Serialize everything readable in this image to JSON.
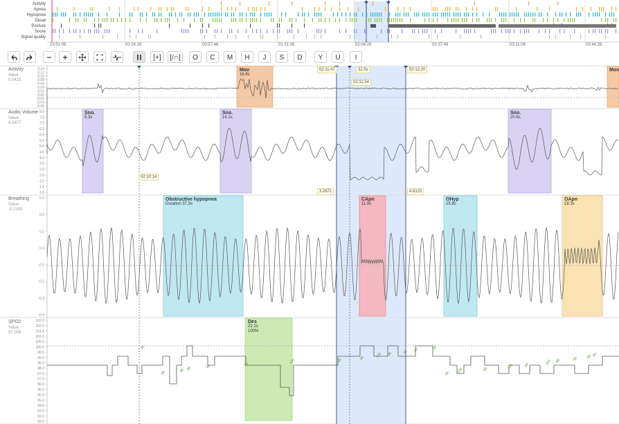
{
  "overview": {
    "row_labels": [
      "Activity",
      "Apnea",
      "Hypopnea",
      "Desat",
      "Posture",
      "Snore",
      "Signal quality"
    ],
    "time_labels": [
      "23:51:06",
      "00:24:26",
      "00:57:46",
      "01:31:06",
      "02:04:26",
      "02:37:46",
      "03:11:06",
      "03:44:26"
    ]
  },
  "toolbar": {
    "letters": [
      "O",
      "C",
      "M",
      "H",
      "J",
      "S",
      "D",
      "Y",
      "U",
      "I"
    ],
    "icons": [
      "undo-icon",
      "redo-icon",
      "zoom-out-icon",
      "zoom-in-icon",
      "move-icon",
      "fit-icon",
      "waveform-icon",
      "pause-icon",
      "expand-bracket-icon",
      "expand-wave-icon"
    ],
    "bracket_label": "[+]",
    "wave_label": "[/∩]"
  },
  "tracks": {
    "activity": {
      "name": "Activity",
      "value_label": "Value",
      "value": "0.0415",
      "ticks": [
        "0.14",
        "0.12",
        "0.10",
        "0.08",
        "0.06",
        "0.04",
        "0.02",
        "0.00",
        "-0.02",
        "-0.04",
        "-0.06"
      ]
    },
    "audio": {
      "name": "Audio Volume",
      "value_label": "Value",
      "value": "4.5677",
      "ticks": [
        "8.0",
        "7.5",
        "7.0",
        "6.5",
        "6.0",
        "5.5",
        "5.0",
        "4.5",
        "4.0",
        "3.5",
        "3.0",
        "2.5",
        "2.0",
        "1.5",
        "1.0"
      ]
    },
    "breathing": {
      "name": "Breathing",
      "value_label": "Value",
      "value": "-0.2183",
      "ticks": [
        "0.3",
        "0.2",
        "0.1",
        "0.0",
        "-0.1",
        "-0.2",
        "-0.3",
        "-0.4"
      ]
    },
    "spo2": {
      "name": "SPO2",
      "value_label": "Value",
      "value": "97.000",
      "ticks": [
        "102.5",
        "102.0",
        "101.5",
        "101.0",
        "100.5",
        "100.0",
        "99.5",
        "99.0",
        "98.5",
        "98.0",
        "97.5",
        "97.0",
        "96.5",
        "96.0",
        "95.5",
        "95.0",
        "94.5",
        "94.0",
        "93.5",
        "93.0"
      ]
    }
  },
  "events": {
    "mov1": {
      "title": "Mov",
      "dur": "16.8s"
    },
    "mov2": {
      "title": "Mov"
    },
    "sno1": {
      "title": "Sno.",
      "dur": "9.3s"
    },
    "sno2": {
      "title": "Sno.",
      "dur": "14.1s"
    },
    "sno3": {
      "title": "Sno.",
      "dur": "20.6s"
    },
    "obs": {
      "title": "Obstructive hypopnea",
      "dur": "Duration 37.3s"
    },
    "capn": {
      "title": "CApn",
      "dur": "11.9s"
    },
    "ohyp": {
      "title": "OHyp",
      "dur": "15.8s"
    },
    "oapn": {
      "title": "OApn",
      "dur": "18.3s"
    },
    "des": {
      "title": "Des",
      "dur": "22.1s",
      "pct": "100%"
    }
  },
  "tags": {
    "t1": "02:11:47",
    "t2": "32.5s",
    "t3": "02:12:20",
    "t4": "02:11:54",
    "t5": "02:10:14",
    "t6": "3.2671",
    "t7": "4.8123"
  },
  "spo2_labels": [
    "99",
    "99",
    "99",
    "99",
    "99",
    "99",
    "100",
    "99",
    "99",
    "100",
    "99",
    "97",
    "99",
    "99",
    "99",
    "100",
    "99",
    "100",
    "99",
    "100",
    "99",
    "99",
    "99",
    "99",
    "97",
    "97",
    "97",
    "97",
    "97",
    "97",
    "97",
    "97"
  ],
  "colors": {
    "mov": "#f4c9a6",
    "sno": "#d9d2f2",
    "hyp": "#bfe8f0",
    "capn": "#f3b8c0",
    "oapn": "#fbe2b3",
    "des": "#cdeab5",
    "sel": "#dde9fb"
  }
}
